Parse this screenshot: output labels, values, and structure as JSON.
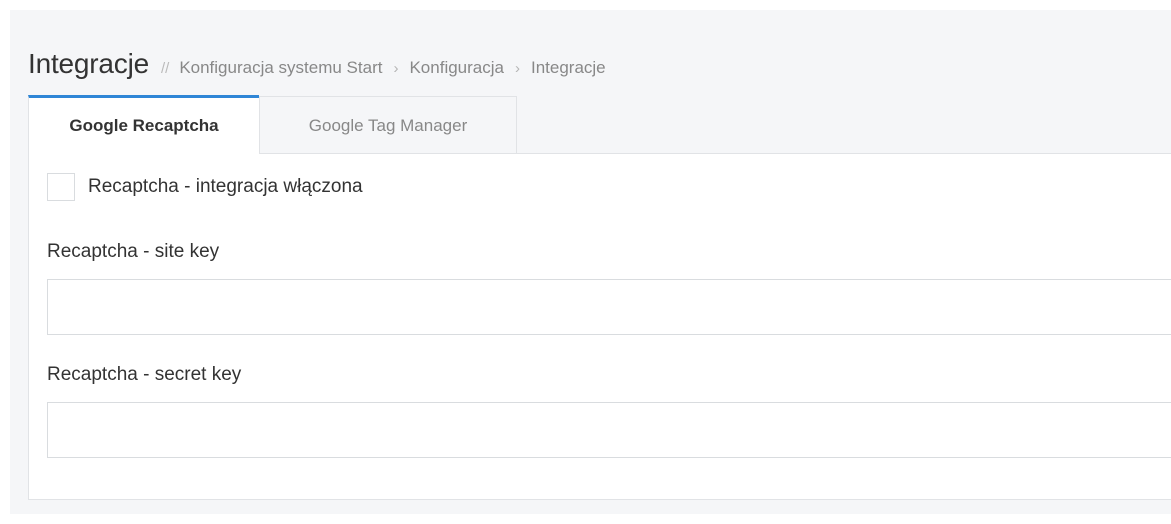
{
  "header": {
    "title": "Integracje",
    "divider": "//",
    "breadcrumb": [
      "Konfiguracja systemu Start",
      "Konfiguracja",
      "Integracje"
    ],
    "separator": "›"
  },
  "tabs": [
    {
      "label": "Google Recaptcha",
      "active": true
    },
    {
      "label": "Google Tag Manager",
      "active": false
    }
  ],
  "form": {
    "enabled_checkbox": {
      "label": "Recaptcha - integracja włączona",
      "checked": false
    },
    "site_key": {
      "label": "Recaptcha - site key",
      "value": ""
    },
    "secret_key": {
      "label": "Recaptcha - secret key",
      "value": ""
    }
  },
  "colors": {
    "accent": "#2f86d6",
    "background": "#f5f6f8"
  }
}
